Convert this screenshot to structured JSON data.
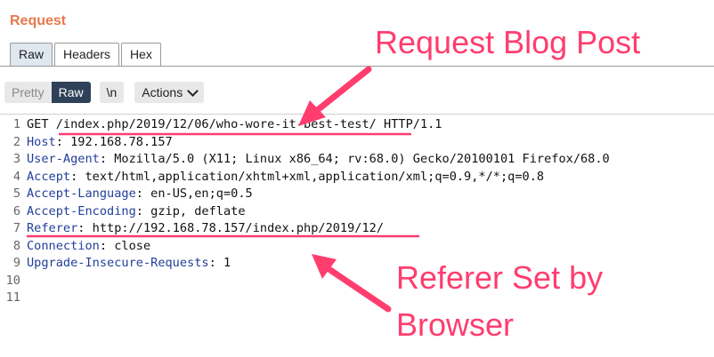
{
  "panel": {
    "title": "Request"
  },
  "tabs": [
    "Raw",
    "Headers",
    "Hex"
  ],
  "toolbar": {
    "pretty": "Pretty",
    "raw": "Raw",
    "newline": "\\n",
    "actions": "Actions"
  },
  "lines": [
    {
      "num": "1",
      "key": "",
      "sep": "",
      "val": "GET /index.php/2019/12/06/who-wore-it-best-test/ HTTP/1.1"
    },
    {
      "num": "2",
      "key": "Host",
      "sep": ": ",
      "val": "192.168.78.157"
    },
    {
      "num": "3",
      "key": "User-Agent",
      "sep": ": ",
      "val": "Mozilla/5.0 (X11; Linux x86_64; rv:68.0) Gecko/20100101 Firefox/68.0"
    },
    {
      "num": "4",
      "key": "Accept",
      "sep": ": ",
      "val": "text/html,application/xhtml+xml,application/xml;q=0.9,*/*;q=0.8"
    },
    {
      "num": "5",
      "key": "Accept-Language",
      "sep": ": ",
      "val": "en-US,en;q=0.5"
    },
    {
      "num": "6",
      "key": "Accept-Encoding",
      "sep": ": ",
      "val": "gzip, deflate"
    },
    {
      "num": "7",
      "key": "Referer",
      "sep": ": ",
      "val": "http://192.168.78.157/index.php/2019/12/"
    },
    {
      "num": "8",
      "key": "Connection",
      "sep": ": ",
      "val": "close"
    },
    {
      "num": "9",
      "key": "Upgrade-Insecure-Requests",
      "sep": ": ",
      "val": "1"
    },
    {
      "num": "10",
      "key": "",
      "sep": "",
      "val": ""
    },
    {
      "num": "11",
      "key": "",
      "sep": "",
      "val": ""
    }
  ],
  "annotations": {
    "top": "Request Blog Post",
    "bottom_line1": "Referer Set by",
    "bottom_line2": "Browser",
    "color": "#ff3d6e"
  }
}
